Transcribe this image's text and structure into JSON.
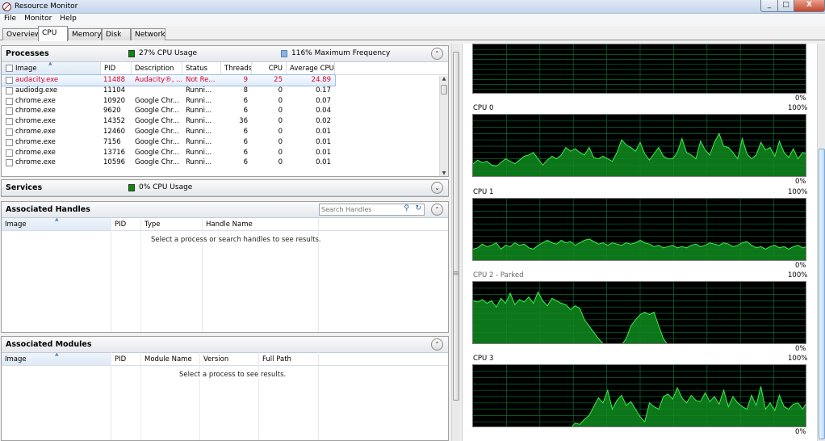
{
  "window": {
    "title": "Resource Monitor",
    "close_label": "X",
    "max_label": "□",
    "min_label": "_"
  },
  "menu": [
    "File",
    "Monitor",
    "Help"
  ],
  "tabs": [
    {
      "label": "Overview",
      "active": false
    },
    {
      "label": "CPU",
      "active": true
    },
    {
      "label": "Memory",
      "active": false
    },
    {
      "label": "Disk",
      "active": false
    },
    {
      "label": "Network",
      "active": false
    }
  ],
  "processes": {
    "title": "Processes",
    "cpu_usage": "27% CPU Usage",
    "max_freq": "116% Maximum Frequency",
    "columns": [
      "Image",
      "PID",
      "Description",
      "Status",
      "Threads",
      "CPU",
      "Average CPU"
    ],
    "rows": [
      {
        "image": "audacity.exe",
        "pid": "11488",
        "desc": "Audacity®, ...",
        "status": "Not Re...",
        "threads": "9",
        "cpu": "25",
        "avg": "24.89",
        "selected": true
      },
      {
        "image": "audiodg.exe",
        "pid": "11104",
        "desc": "",
        "status": "Runni...",
        "threads": "8",
        "cpu": "0",
        "avg": "0.17",
        "selected": false
      },
      {
        "image": "chrome.exe",
        "pid": "10920",
        "desc": "Google Chr...",
        "status": "Runni...",
        "threads": "6",
        "cpu": "0",
        "avg": "0.07",
        "selected": false
      },
      {
        "image": "chrome.exe",
        "pid": "9620",
        "desc": "Google Chr...",
        "status": "Runni...",
        "threads": "6",
        "cpu": "0",
        "avg": "0.04",
        "selected": false
      },
      {
        "image": "chrome.exe",
        "pid": "14352",
        "desc": "Google Chr...",
        "status": "Runni...",
        "threads": "36",
        "cpu": "0",
        "avg": "0.02",
        "selected": false
      },
      {
        "image": "chrome.exe",
        "pid": "12460",
        "desc": "Google Chr...",
        "status": "Runni...",
        "threads": "6",
        "cpu": "0",
        "avg": "0.01",
        "selected": false
      },
      {
        "image": "chrome.exe",
        "pid": "7156",
        "desc": "Google Chr...",
        "status": "Runni...",
        "threads": "6",
        "cpu": "0",
        "avg": "0.01",
        "selected": false
      },
      {
        "image": "chrome.exe",
        "pid": "13716",
        "desc": "Google Chr...",
        "status": "Runni...",
        "threads": "6",
        "cpu": "0",
        "avg": "0.01",
        "selected": false
      },
      {
        "image": "chrome.exe",
        "pid": "10596",
        "desc": "Google Chr...",
        "status": "Runni...",
        "threads": "6",
        "cpu": "0",
        "avg": "0.01",
        "selected": false
      }
    ]
  },
  "services": {
    "title": "Services",
    "cpu_usage": "0% CPU Usage"
  },
  "handles": {
    "title": "Associated Handles",
    "search_placeholder": "Search Handles",
    "columns": [
      "Image",
      "PID",
      "Type",
      "Handle Name"
    ],
    "hint": "Select a process or search handles to see results."
  },
  "modules": {
    "title": "Associated Modules",
    "columns": [
      "Image",
      "PID",
      "Module Name",
      "Version",
      "Full Path"
    ],
    "hint": "Select a process to see results."
  },
  "graphs": {
    "overall": {
      "min_label": "0%"
    },
    "cpus": [
      {
        "name": "CPU 0",
        "max_label": "100%",
        "min_label": "0%",
        "parked": false,
        "series": [
          22,
          28,
          24,
          26,
          20,
          18,
          24,
          30,
          26,
          22,
          28,
          34,
          36,
          40,
          30,
          20,
          28,
          34,
          30,
          36,
          48,
          42,
          46,
          40,
          36,
          48,
          32,
          30,
          34,
          30,
          26,
          40,
          60,
          52,
          48,
          42,
          56,
          38,
          28,
          38,
          48,
          34,
          30,
          30,
          40,
          62,
          40,
          36,
          30,
          58,
          44,
          36,
          56,
          70,
          50,
          48,
          40,
          30,
          62,
          38,
          30,
          36,
          56,
          44,
          48,
          34,
          58,
          40,
          32,
          46,
          30,
          40,
          38
        ]
      },
      {
        "name": "CPU 1",
        "max_label": "100%",
        "min_label": "0%",
        "parked": false,
        "series": [
          20,
          22,
          28,
          24,
          26,
          30,
          20,
          26,
          24,
          30,
          26,
          28,
          22,
          20,
          26,
          30,
          34,
          30,
          28,
          34,
          30,
          32,
          26,
          30,
          34,
          36,
          32,
          28,
          30,
          26,
          30,
          28,
          26,
          30,
          28,
          30,
          34,
          30,
          28,
          24,
          26,
          22,
          24,
          26,
          22,
          24,
          22,
          26,
          28,
          24,
          26,
          30,
          28,
          26,
          30,
          28,
          24,
          26,
          30,
          32,
          26,
          22,
          24,
          20,
          24,
          26,
          22,
          24,
          20,
          24,
          26,
          22,
          24
        ]
      },
      {
        "name": "CPU 2 - Parked",
        "max_label": "100%",
        "min_label": "0%",
        "parked": true,
        "series": [
          70,
          68,
          72,
          66,
          70,
          60,
          74,
          66,
          82,
          64,
          72,
          68,
          76,
          66,
          84,
          70,
          62,
          74,
          70,
          66,
          64,
          56,
          62,
          58,
          40,
          30,
          20,
          10,
          2,
          0,
          0,
          0,
          0,
          10,
          30,
          40,
          48,
          52,
          48,
          52,
          30,
          10,
          0,
          0,
          0,
          0,
          2,
          0,
          0,
          0,
          0,
          0,
          0,
          0,
          0,
          0,
          0,
          0,
          0,
          0,
          0,
          0,
          0,
          0,
          0,
          0,
          0,
          0,
          0,
          0,
          0,
          0,
          0
        ]
      },
      {
        "name": "CPU 3",
        "max_label": "100%",
        "min_label": "0%",
        "parked": false,
        "series": [
          0,
          0,
          0,
          0,
          0,
          0,
          0,
          0,
          0,
          0,
          0,
          0,
          0,
          0,
          0,
          0,
          0,
          0,
          0,
          0,
          0,
          0,
          8,
          6,
          14,
          20,
          34,
          48,
          40,
          60,
          30,
          44,
          52,
          36,
          42,
          30,
          18,
          10,
          40,
          34,
          30,
          50,
          54,
          46,
          64,
          48,
          40,
          52,
          44,
          42,
          56,
          42,
          50,
          38,
          60,
          34,
          50,
          40,
          34,
          30,
          52,
          36,
          66,
          30,
          40,
          28,
          52,
          34,
          30,
          38,
          40,
          30,
          42
        ]
      }
    ]
  }
}
